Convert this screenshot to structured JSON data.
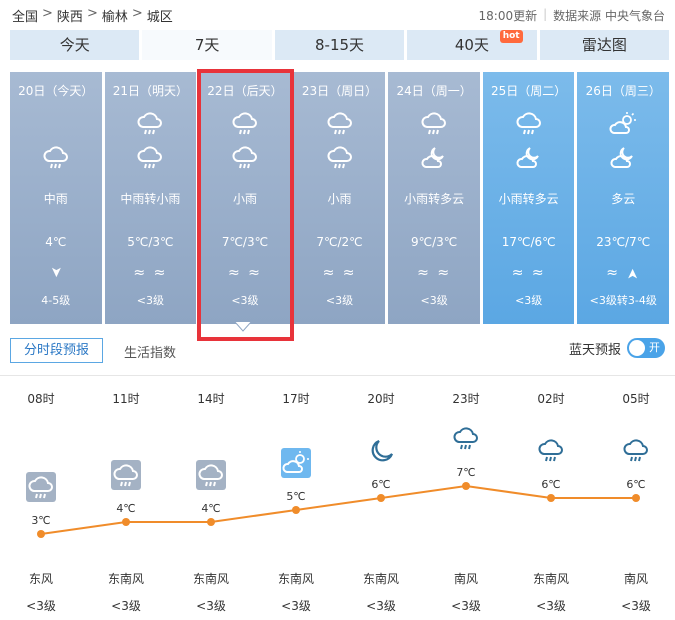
{
  "breadcrumb": [
    "全国",
    "陕西",
    "榆林",
    "城区"
  ],
  "breadcrumb_sep": ">",
  "meta": {
    "updated": "18:00更新",
    "source": "数据来源 中央气象台"
  },
  "tabs": [
    {
      "label": "今天"
    },
    {
      "label": "7天",
      "active": true
    },
    {
      "label": "8-15天"
    },
    {
      "label": "40天",
      "badge": "hot"
    },
    {
      "label": "雷达图"
    }
  ],
  "days": [
    {
      "date": "20日（今天）",
      "icons": [
        "rain-cloud-icon"
      ],
      "cond": "中雨",
      "temp": "4℃",
      "wind_symbol": "➤",
      "wind_level": "4-5级"
    },
    {
      "date": "21日（明天）",
      "icons": [
        "rain-cloud-icon",
        "rain-cloud-icon"
      ],
      "cond": "中雨转小雨",
      "temp": "5℃/3℃",
      "wind_symbol": "≈ ≈",
      "wind_level": "<3级"
    },
    {
      "date": "22日（后天）",
      "icons": [
        "rain-cloud-icon",
        "rain-cloud-icon"
      ],
      "cond": "小雨",
      "temp": "7℃/3℃",
      "wind_symbol": "≈ ≈",
      "wind_level": "<3级"
    },
    {
      "date": "23日（周日）",
      "icons": [
        "rain-cloud-icon",
        "rain-cloud-icon"
      ],
      "cond": "小雨",
      "temp": "7℃/2℃",
      "wind_symbol": "≈ ≈",
      "wind_level": "<3级"
    },
    {
      "date": "24日（周一）",
      "icons": [
        "rain-cloud-icon",
        "cloudy-night-icon"
      ],
      "cond": "小雨转多云",
      "temp": "9℃/3℃",
      "wind_symbol": "≈ ≈",
      "wind_level": "<3级"
    },
    {
      "date": "25日（周二）",
      "icons": [
        "rain-cloud-icon",
        "cloudy-night-icon"
      ],
      "cond": "小雨转多云",
      "temp": "17℃/6℃",
      "wind_symbol": "≈ ≈",
      "wind_level": "<3级"
    },
    {
      "date": "26日（周三）",
      "icons": [
        "partly-sunny-icon",
        "cloudy-night-icon"
      ],
      "cond": "多云",
      "temp": "23℃/7℃",
      "wind_symbol": "≈ ➤",
      "wind_level": "<3级转3-4级"
    }
  ],
  "subtabs": {
    "active": "分时段预报",
    "other": "生活指数"
  },
  "blue_sky": {
    "label": "蓝天预报",
    "toggle": "开"
  },
  "hourly": [
    {
      "time": "08时",
      "temp": "3℃",
      "value": 3,
      "icon": "rain-cloud-icon",
      "wind_dir": "东风",
      "wind_level": "<3级"
    },
    {
      "time": "11时",
      "temp": "4℃",
      "value": 4,
      "icon": "rain-cloud-icon",
      "wind_dir": "东南风",
      "wind_level": "<3级"
    },
    {
      "time": "14时",
      "temp": "4℃",
      "value": 4,
      "icon": "rain-cloud-icon",
      "wind_dir": "东南风",
      "wind_level": "<3级"
    },
    {
      "time": "17时",
      "temp": "5℃",
      "value": 5,
      "icon": "partly-sunny-icon",
      "wind_dir": "东南风",
      "wind_level": "<3级"
    },
    {
      "time": "20时",
      "temp": "6℃",
      "value": 6,
      "icon": "moon-icon",
      "wind_dir": "东南风",
      "wind_level": "<3级"
    },
    {
      "time": "23时",
      "temp": "7℃",
      "value": 7,
      "icon": "rain-icon",
      "wind_dir": "南风",
      "wind_level": "<3级"
    },
    {
      "time": "02时",
      "temp": "6℃",
      "value": 6,
      "icon": "rain-icon",
      "wind_dir": "东南风",
      "wind_level": "<3级"
    },
    {
      "time": "05时",
      "temp": "6℃",
      "value": 6,
      "icon": "rain-icon",
      "wind_dir": "南风",
      "wind_level": "<3级"
    }
  ],
  "colors": {
    "accent": "#5ba7e3",
    "line": "#f08c2a",
    "highlight": "#e8333a"
  }
}
